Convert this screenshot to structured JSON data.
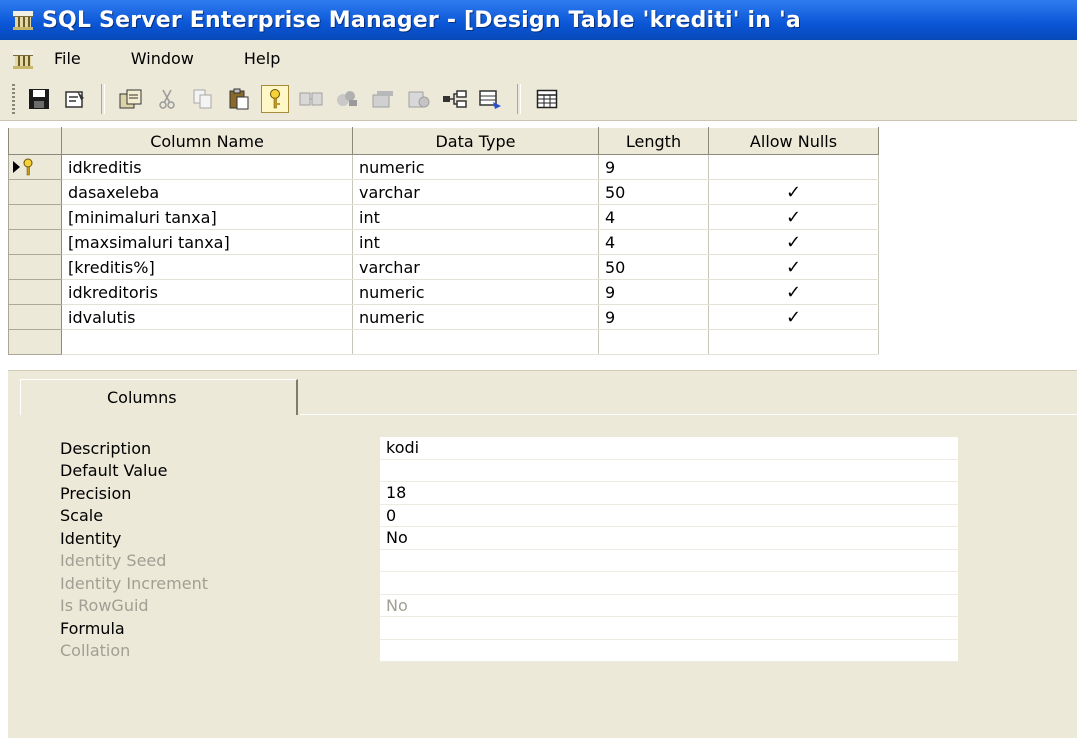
{
  "window": {
    "title": "SQL Server Enterprise Manager - [Design Table 'krediti' in 'a"
  },
  "menu": {
    "items": [
      "File",
      "Window",
      "Help"
    ]
  },
  "toolbar": {
    "buttons": [
      {
        "icon": "save-icon"
      },
      {
        "icon": "properties-icon"
      },
      {
        "icon": "generate-script-icon"
      },
      {
        "icon": "cut-icon"
      },
      {
        "icon": "copy-icon"
      },
      {
        "icon": "paste-icon"
      },
      {
        "icon": "primary-key-icon",
        "pressed": true
      },
      {
        "icon": "relationships-icon"
      },
      {
        "icon": "indexes-keys-icon"
      },
      {
        "icon": "constraints-icon"
      },
      {
        "icon": "triggers-icon"
      },
      {
        "icon": "dependencies-icon"
      },
      {
        "icon": "insert-column-icon"
      },
      {
        "icon": "table-view-icon"
      }
    ]
  },
  "grid": {
    "headers": {
      "column_name": "Column Name",
      "data_type": "Data Type",
      "length": "Length",
      "allow_nulls": "Allow Nulls"
    },
    "rows": [
      {
        "name": "idkreditis",
        "type": "numeric",
        "length": "9",
        "allow_nulls": false,
        "primary_key": true,
        "current": true
      },
      {
        "name": "dasaxeleba",
        "type": "varchar",
        "length": "50",
        "allow_nulls": true
      },
      {
        "name": "[minimaluri tanxa]",
        "type": "int",
        "length": "4",
        "allow_nulls": true
      },
      {
        "name": "[maxsimaluri tanxa]",
        "type": "int",
        "length": "4",
        "allow_nulls": true
      },
      {
        "name": "[kreditis%]",
        "type": "varchar",
        "length": "50",
        "allow_nulls": true
      },
      {
        "name": "idkreditoris",
        "type": "numeric",
        "length": "9",
        "allow_nulls": true
      },
      {
        "name": "idvalutis",
        "type": "numeric",
        "length": "9",
        "allow_nulls": true
      },
      {
        "name": "",
        "type": "",
        "length": "",
        "allow_nulls": false
      }
    ],
    "check_glyph": "✓"
  },
  "properties": {
    "tab_label": "Columns",
    "rows": [
      {
        "label": "Description",
        "value": "kodi",
        "enabled": true
      },
      {
        "label": "Default Value",
        "value": "",
        "enabled": true
      },
      {
        "label": "Precision",
        "value": "18",
        "enabled": true
      },
      {
        "label": "Scale",
        "value": "0",
        "enabled": true
      },
      {
        "label": "Identity",
        "value": "No",
        "enabled": true
      },
      {
        "label": "Identity Seed",
        "value": "",
        "enabled": false
      },
      {
        "label": "Identity Increment",
        "value": "",
        "enabled": false
      },
      {
        "label": "Is RowGuid",
        "value": "No",
        "enabled": false
      },
      {
        "label": "Formula",
        "value": "",
        "enabled": true
      },
      {
        "label": "Collation",
        "value": "",
        "enabled": false
      }
    ]
  }
}
